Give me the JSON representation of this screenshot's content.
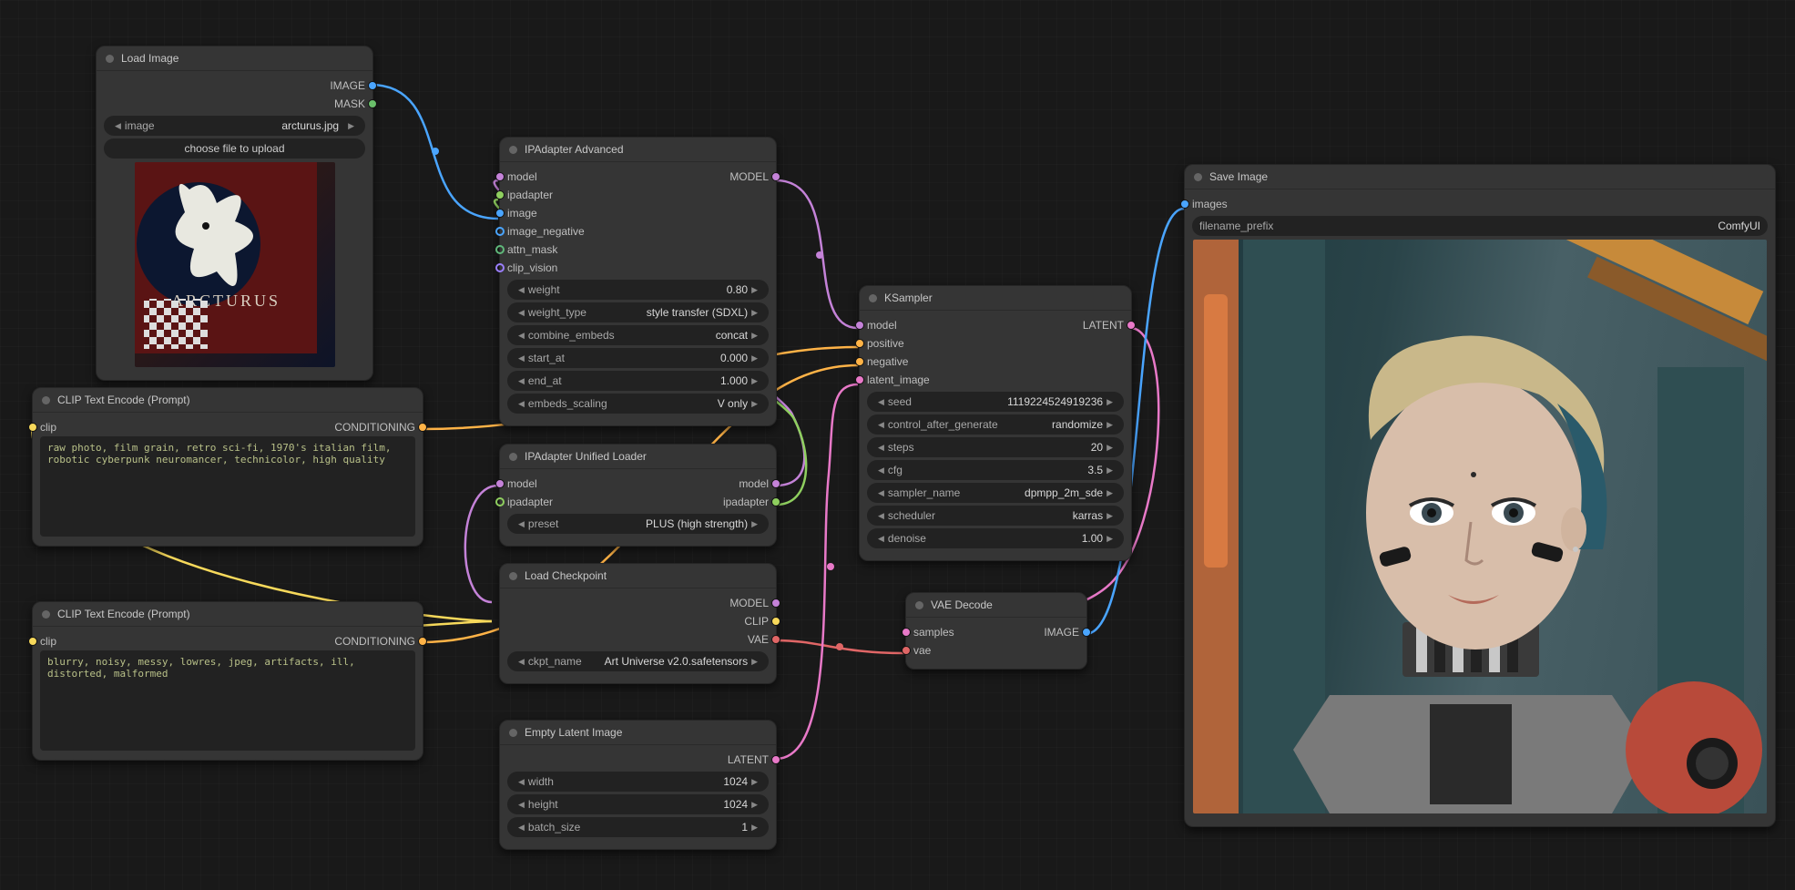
{
  "loadimage": {
    "title": "Load Image",
    "out_image": "IMAGE",
    "out_mask": "MASK",
    "widget_label": "image",
    "widget_value": "arcturus.jpg",
    "button": "choose file to upload"
  },
  "clip_pos": {
    "title": "CLIP Text Encode (Prompt)",
    "in_clip": "clip",
    "out_cond": "CONDITIONING",
    "text": "raw photo, film grain, retro sci-fi, 1970's italian film, robotic cyberpunk neuromancer, technicolor, high quality"
  },
  "clip_neg": {
    "title": "CLIP Text Encode (Prompt)",
    "in_clip": "clip",
    "out_cond": "CONDITIONING",
    "text": "blurry, noisy, messy, lowres, jpeg, artifacts, ill, distorted, malformed"
  },
  "ipadv": {
    "title": "IPAdapter Advanced",
    "in_model": "model",
    "in_ipa": "ipadapter",
    "in_image": "image",
    "in_imgneg": "image_negative",
    "in_attn": "attn_mask",
    "in_clipv": "clip_vision",
    "out_model": "MODEL",
    "w_weight_l": "weight",
    "w_weight_v": "0.80",
    "w_type_l": "weight_type",
    "w_type_v": "style transfer (SDXL)",
    "w_comb_l": "combine_embeds",
    "w_comb_v": "concat",
    "w_start_l": "start_at",
    "w_start_v": "0.000",
    "w_end_l": "end_at",
    "w_end_v": "1.000",
    "w_scale_l": "embeds_scaling",
    "w_scale_v": "V only"
  },
  "iploader": {
    "title": "IPAdapter Unified Loader",
    "in_model": "model",
    "in_ipa": "ipadapter",
    "out_model": "model",
    "out_ipa": "ipadapter",
    "w_preset_l": "preset",
    "w_preset_v": "PLUS (high strength)"
  },
  "ckpt": {
    "title": "Load Checkpoint",
    "out_model": "MODEL",
    "out_clip": "CLIP",
    "out_vae": "VAE",
    "w_l": "ckpt_name",
    "w_v": "Art Universe v2.0.safetensors"
  },
  "empty": {
    "title": "Empty Latent Image",
    "out_latent": "LATENT",
    "w_w_l": "width",
    "w_w_v": "1024",
    "w_h_l": "height",
    "w_h_v": "1024",
    "w_b_l": "batch_size",
    "w_b_v": "1"
  },
  "ksampler": {
    "title": "KSampler",
    "in_model": "model",
    "in_pos": "positive",
    "in_neg": "negative",
    "in_latent": "latent_image",
    "out_latent": "LATENT",
    "w_seed_l": "seed",
    "w_seed_v": "1119224524919236",
    "w_ctrl_l": "control_after_generate",
    "w_ctrl_v": "randomize",
    "w_steps_l": "steps",
    "w_steps_v": "20",
    "w_cfg_l": "cfg",
    "w_cfg_v": "3.5",
    "w_samp_l": "sampler_name",
    "w_samp_v": "dpmpp_2m_sde",
    "w_sched_l": "scheduler",
    "w_sched_v": "karras",
    "w_den_l": "denoise",
    "w_den_v": "1.00"
  },
  "vaedec": {
    "title": "VAE Decode",
    "in_samples": "samples",
    "in_vae": "vae",
    "out_image": "IMAGE"
  },
  "save": {
    "title": "Save Image",
    "in_images": "images",
    "w_l": "filename_prefix",
    "w_v": "ComfyUI"
  }
}
